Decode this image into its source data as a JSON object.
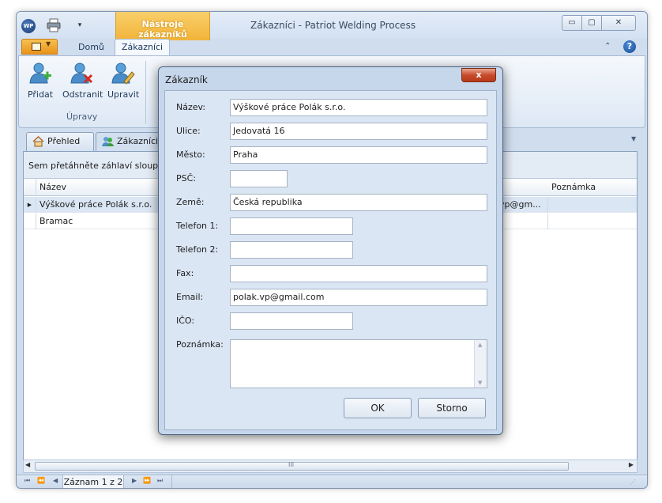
{
  "window": {
    "title": "Zákazníci - Patriot Welding Process",
    "app_icon_text": "WP",
    "context_tab_header": "Nástroje zákazníků",
    "buttons": {
      "minimize": "▭",
      "maximize": "▢",
      "close": "✕"
    }
  },
  "ribbon": {
    "tabs": [
      {
        "label": "Domů"
      },
      {
        "label": "Zákazníci",
        "active": true
      }
    ],
    "group": {
      "label": "Úpravy",
      "buttons": [
        {
          "label": "Přidat",
          "icon": "user-add-icon"
        },
        {
          "label": "Odstranit",
          "icon": "user-remove-icon"
        },
        {
          "label": "Upravit",
          "icon": "user-edit-icon"
        }
      ]
    },
    "help_label": "?"
  },
  "document_tabs": [
    {
      "label": "Přehled",
      "icon": "home-icon"
    },
    {
      "label": "Zákazníci",
      "icon": "users-icon",
      "active": true
    }
  ],
  "grid": {
    "group_panel_hint": "Sem přetáhněte záhlaví sloupce",
    "columns": {
      "name": "Název",
      "note": "Poznámka"
    },
    "rows": [
      {
        "name": "Výškové práce Polák s.r.o.",
        "email": "vp@gm...",
        "note": "",
        "selected": true
      },
      {
        "name": "Bramac",
        "email": "",
        "note": ""
      }
    ],
    "hscroll_grip": "III"
  },
  "statusbar": {
    "record_text": "Záznam 1 z 2"
  },
  "dialog": {
    "title": "Zákazník",
    "close": "x",
    "fields": {
      "name": {
        "label": "Název:",
        "value": "Výškové práce Polák s.r.o."
      },
      "street": {
        "label": "Ulice:",
        "value": "Jedovatá 16"
      },
      "city": {
        "label": "Město:",
        "value": "Praha"
      },
      "zip": {
        "label": "PSČ:",
        "value": ""
      },
      "country": {
        "label": "Země:",
        "value": "Česká republika"
      },
      "phone1": {
        "label": "Telefon 1:",
        "value": ""
      },
      "phone2": {
        "label": "Telefon 2:",
        "value": ""
      },
      "fax": {
        "label": "Fax:",
        "value": ""
      },
      "email": {
        "label": "Email:",
        "value": "polak.vp@gmail.com"
      },
      "ico": {
        "label": "IČO:",
        "value": ""
      },
      "note": {
        "label": "Poznámka:",
        "value": ""
      }
    },
    "ok_label": "OK",
    "cancel_label": "Storno"
  },
  "colors": {
    "accent_orange": "#f2b43a",
    "close_red": "#c74b2b",
    "selection": "#dae6f3"
  }
}
